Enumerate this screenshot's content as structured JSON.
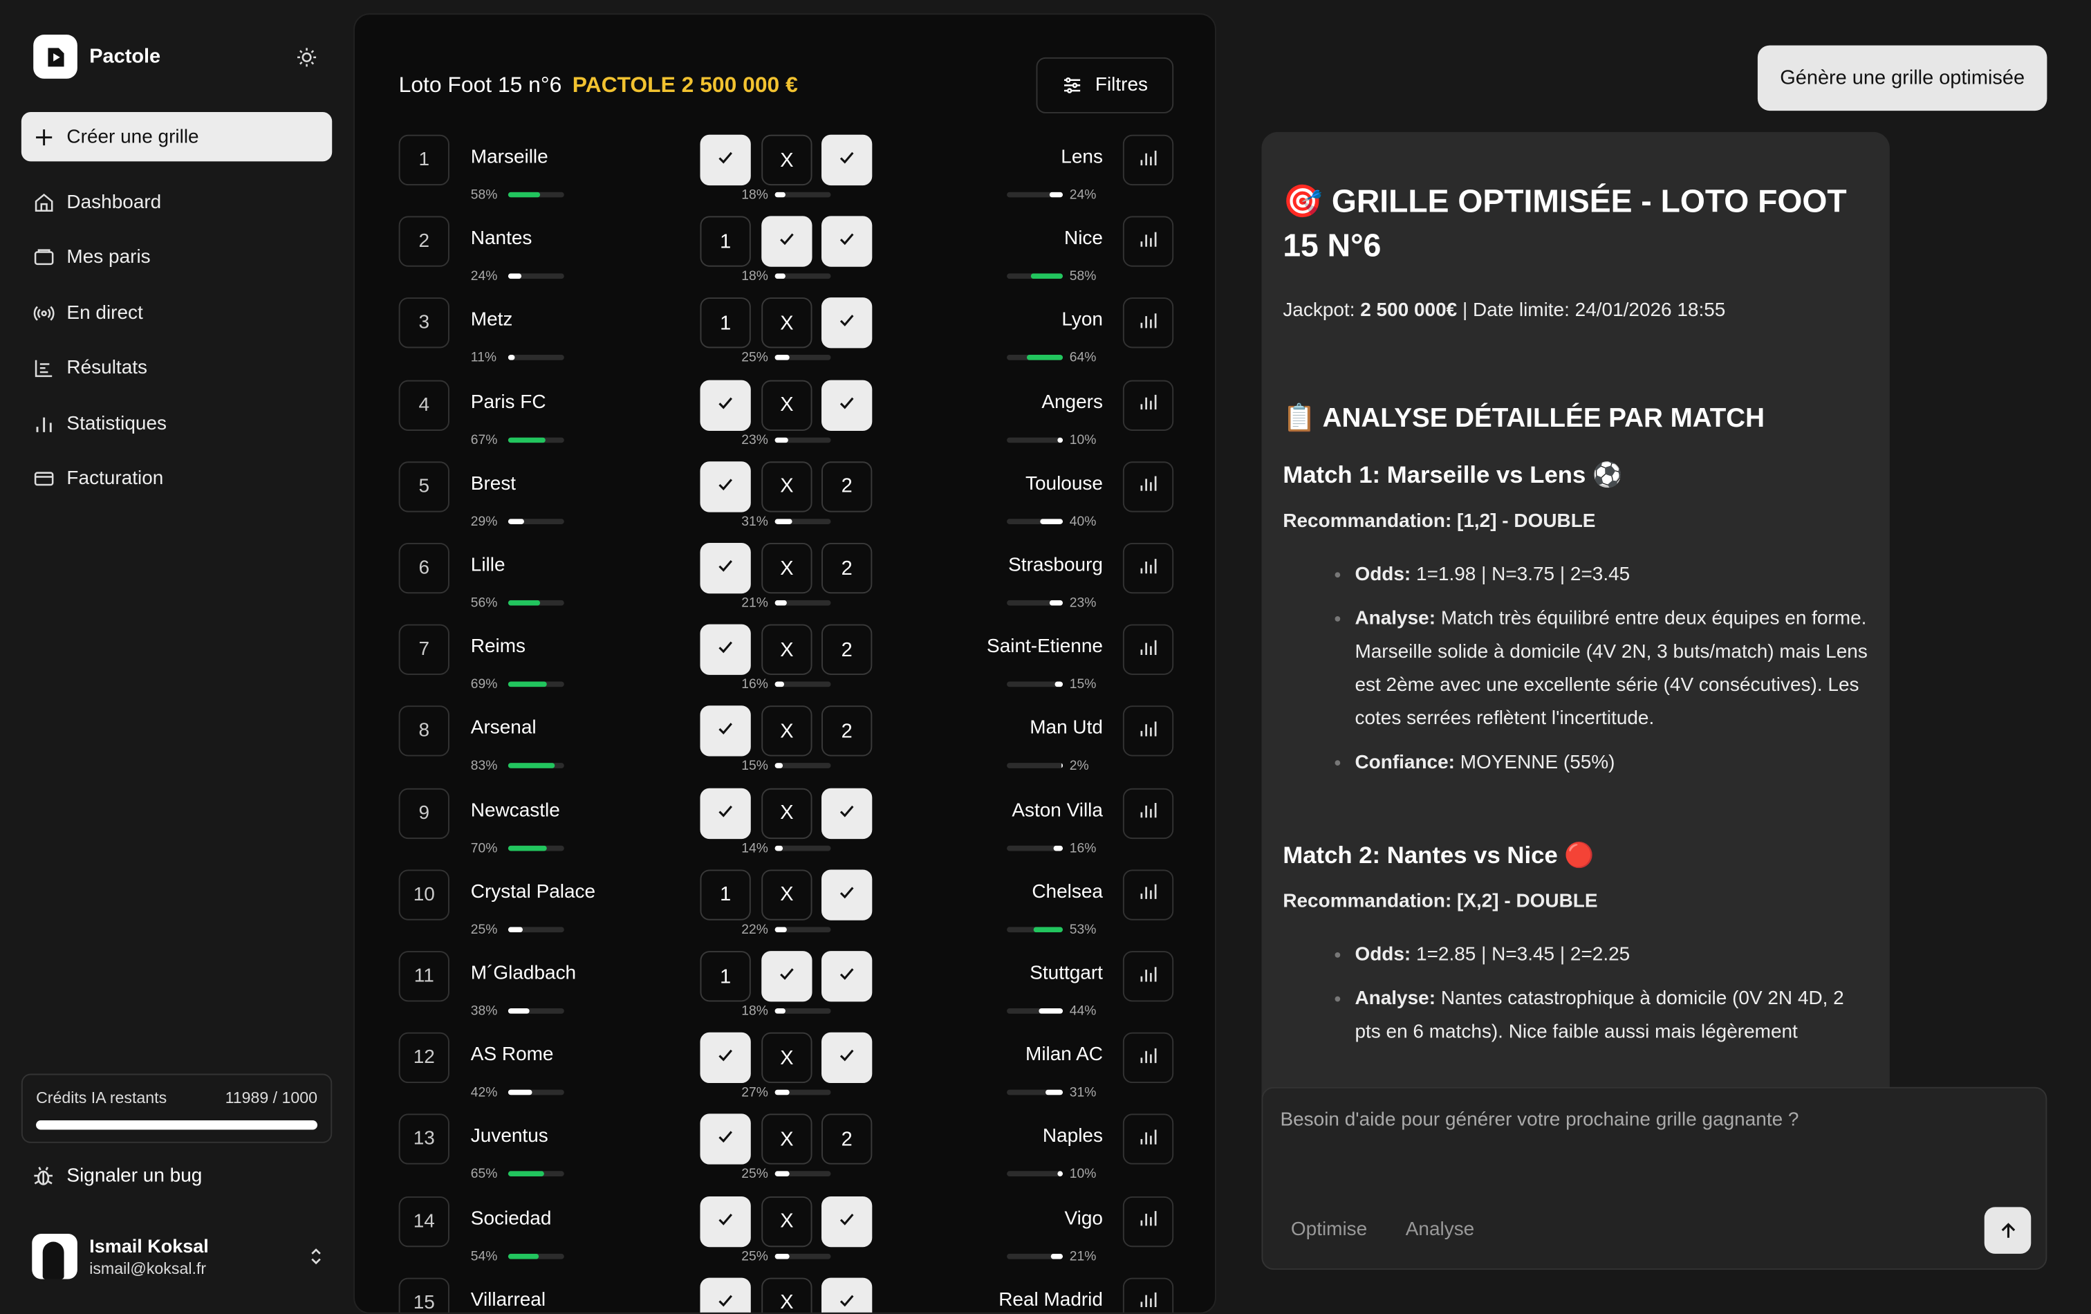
{
  "app": {
    "name": "Pactole"
  },
  "sidebar": {
    "create_label": "Créer une grille",
    "items": [
      {
        "label": "Dashboard",
        "icon": "home-icon"
      },
      {
        "label": "Mes paris",
        "icon": "ticket-icon"
      },
      {
        "label": "En direct",
        "icon": "live-icon"
      },
      {
        "label": "Résultats",
        "icon": "results-icon"
      },
      {
        "label": "Statistiques",
        "icon": "stats-icon"
      },
      {
        "label": "Facturation",
        "icon": "card-icon"
      }
    ],
    "credits_label": "Crédits IA restants",
    "credits_value": "11989 / 1000",
    "bug_label": "Signaler un bug",
    "user_name": "Ismail Koksal",
    "user_email": "ismail@koksal.fr"
  },
  "grid": {
    "title": "Loto Foot 15 n°6",
    "jackpot": "PACTOLE 2 500 000 €",
    "filters_label": "Filtres",
    "matches": [
      {
        "n": "1",
        "home": "Marseille",
        "home_pct": "58%",
        "home_v": 58,
        "draw_pct": "18%",
        "draw_v": 18,
        "away": "Lens",
        "away_pct": "24%",
        "away_v": 24,
        "o1": "",
        "oX": "X",
        "o2": "",
        "s1": true,
        "sX": false,
        "s2": true
      },
      {
        "n": "2",
        "home": "Nantes",
        "home_pct": "24%",
        "home_v": 24,
        "draw_pct": "18%",
        "draw_v": 18,
        "away": "Nice",
        "away_pct": "58%",
        "away_v": 58,
        "o1": "1",
        "oX": "",
        "o2": "",
        "s1": false,
        "sX": true,
        "s2": true
      },
      {
        "n": "3",
        "home": "Metz",
        "home_pct": "11%",
        "home_v": 11,
        "draw_pct": "25%",
        "draw_v": 25,
        "away": "Lyon",
        "away_pct": "64%",
        "away_v": 64,
        "o1": "1",
        "oX": "X",
        "o2": "",
        "s1": false,
        "sX": false,
        "s2": true
      },
      {
        "n": "4",
        "home": "Paris FC",
        "home_pct": "67%",
        "home_v": 67,
        "draw_pct": "23%",
        "draw_v": 23,
        "away": "Angers",
        "away_pct": "10%",
        "away_v": 10,
        "o1": "",
        "oX": "X",
        "o2": "",
        "s1": true,
        "sX": false,
        "s2": true
      },
      {
        "n": "5",
        "home": "Brest",
        "home_pct": "29%",
        "home_v": 29,
        "draw_pct": "31%",
        "draw_v": 31,
        "away": "Toulouse",
        "away_pct": "40%",
        "away_v": 40,
        "o1": "",
        "oX": "X",
        "o2": "2",
        "s1": true,
        "sX": false,
        "s2": false
      },
      {
        "n": "6",
        "home": "Lille",
        "home_pct": "56%",
        "home_v": 56,
        "draw_pct": "21%",
        "draw_v": 21,
        "away": "Strasbourg",
        "away_pct": "23%",
        "away_v": 23,
        "o1": "",
        "oX": "X",
        "o2": "2",
        "s1": true,
        "sX": false,
        "s2": false
      },
      {
        "n": "7",
        "home": "Reims",
        "home_pct": "69%",
        "home_v": 69,
        "draw_pct": "16%",
        "draw_v": 16,
        "away": "Saint-Etienne",
        "away_pct": "15%",
        "away_v": 15,
        "o1": "",
        "oX": "X",
        "o2": "2",
        "s1": true,
        "sX": false,
        "s2": false
      },
      {
        "n": "8",
        "home": "Arsenal",
        "home_pct": "83%",
        "home_v": 83,
        "draw_pct": "15%",
        "draw_v": 15,
        "away": "Man Utd",
        "away_pct": "2%",
        "away_v": 2,
        "o1": "",
        "oX": "X",
        "o2": "2",
        "s1": true,
        "sX": false,
        "s2": false
      },
      {
        "n": "9",
        "home": "Newcastle",
        "home_pct": "70%",
        "home_v": 70,
        "draw_pct": "14%",
        "draw_v": 14,
        "away": "Aston Villa",
        "away_pct": "16%",
        "away_v": 16,
        "o1": "",
        "oX": "X",
        "o2": "",
        "s1": true,
        "sX": false,
        "s2": true
      },
      {
        "n": "10",
        "home": "Crystal Palace",
        "home_pct": "25%",
        "home_v": 25,
        "draw_pct": "22%",
        "draw_v": 22,
        "away": "Chelsea",
        "away_pct": "53%",
        "away_v": 53,
        "o1": "1",
        "oX": "X",
        "o2": "",
        "s1": false,
        "sX": false,
        "s2": true
      },
      {
        "n": "11",
        "home": "M´Gladbach",
        "home_pct": "38%",
        "home_v": 38,
        "draw_pct": "18%",
        "draw_v": 18,
        "away": "Stuttgart",
        "away_pct": "44%",
        "away_v": 44,
        "o1": "1",
        "oX": "",
        "o2": "",
        "s1": false,
        "sX": true,
        "s2": true
      },
      {
        "n": "12",
        "home": "AS Rome",
        "home_pct": "42%",
        "home_v": 42,
        "draw_pct": "27%",
        "draw_v": 27,
        "away": "Milan AC",
        "away_pct": "31%",
        "away_v": 31,
        "o1": "",
        "oX": "X",
        "o2": "",
        "s1": true,
        "sX": false,
        "s2": true
      },
      {
        "n": "13",
        "home": "Juventus",
        "home_pct": "65%",
        "home_v": 65,
        "draw_pct": "25%",
        "draw_v": 25,
        "away": "Naples",
        "away_pct": "10%",
        "away_v": 10,
        "o1": "",
        "oX": "X",
        "o2": "2",
        "s1": true,
        "sX": false,
        "s2": false
      },
      {
        "n": "14",
        "home": "Sociedad",
        "home_pct": "54%",
        "home_v": 54,
        "draw_pct": "25%",
        "draw_v": 25,
        "away": "Vigo",
        "away_pct": "21%",
        "away_v": 21,
        "o1": "",
        "oX": "X",
        "o2": "",
        "s1": true,
        "sX": false,
        "s2": true
      },
      {
        "n": "15",
        "home": "Villarreal",
        "home_pct": "",
        "home_v": 0,
        "draw_pct": "",
        "draw_v": 0,
        "away": "Real Madrid",
        "away_pct": "",
        "away_v": 0,
        "o1": "",
        "oX": "X",
        "o2": "",
        "s1": true,
        "sX": false,
        "s2": true
      }
    ]
  },
  "assistant": {
    "generate_label": "Génère une grille optimisée",
    "title": "GRILLE OPTIMISÉE - LOTO FOOT 15 N°6",
    "jackpot_label": "Jackpot:",
    "jackpot_value": "2 500 000€",
    "deadline": "| Date limite: 24/01/2026 18:55",
    "analysis_title": "ANALYSE DÉTAILLÉE PAR MATCH",
    "match1_title": "Match 1: Marseille vs Lens",
    "match1_rec": "Recommandation: [1,2] - DOUBLE",
    "match1_odds_label": "Odds:",
    "match1_odds": "1=1.98 | N=3.75 | 2=3.45",
    "match1_analysis_label": "Analyse:",
    "match1_analysis": "Match très équilibré entre deux équipes en forme. Marseille solide à domicile (4V 2N, 3 buts/match) mais Lens est 2ème avec une excellente série (4V consécutives). Les cotes serrées reflètent l'incertitude.",
    "match1_conf_label": "Confiance:",
    "match1_conf": "MOYENNE (55%)",
    "match2_title": "Match 2: Nantes vs Nice",
    "match2_rec": "Recommandation: [X,2] - DOUBLE",
    "match2_odds_label": "Odds:",
    "match2_odds": "1=2.85 | N=3.45 | 2=2.25",
    "match2_analysis_label": "Analyse:",
    "match2_analysis": "Nantes catastrophique à domicile (0V 2N 4D, 2 pts en 6 matchs). Nice faible aussi mais légèrement",
    "input_placeholder": "Besoin d'aide pour générer votre prochaine grille gagnante ?",
    "chip_optimise": "Optimise",
    "chip_analyse": "Analyse"
  },
  "colors": {
    "accent": "#f2c230",
    "bar_green": "#22c55e",
    "bar_white": "#ffffff"
  }
}
